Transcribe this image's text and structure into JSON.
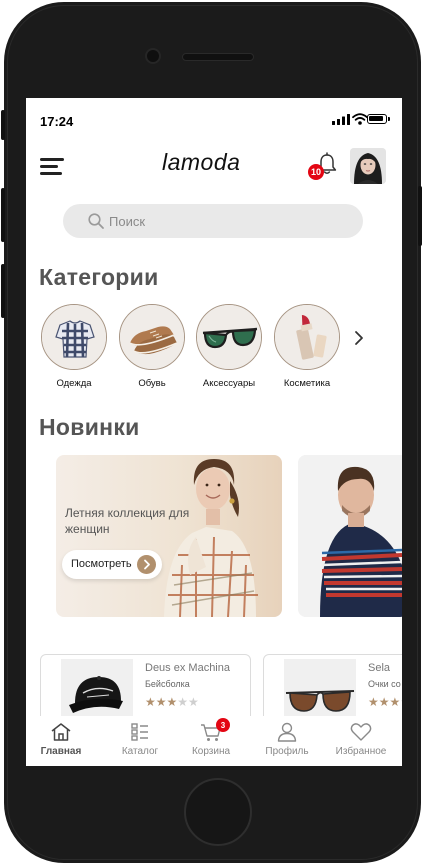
{
  "status_bar": {
    "time": "17:24"
  },
  "header": {
    "logo": "lamoda",
    "notifications_count": "10"
  },
  "search": {
    "placeholder": "Поиск"
  },
  "categories": {
    "title": "Категории",
    "items": [
      {
        "label": "Одежда",
        "icon": "shirt-icon"
      },
      {
        "label": "Обувь",
        "icon": "shoes-icon"
      },
      {
        "label": "Аксессуары",
        "icon": "sunglasses-icon"
      },
      {
        "label": "Косметика",
        "icon": "lipstick-icon"
      }
    ]
  },
  "new_arrivals": {
    "title": "Новинки",
    "banner": {
      "text": "Летняя коллекция для женщин",
      "button_label": "Посмотреть"
    }
  },
  "products": [
    {
      "brand": "Deus ex Machina",
      "type": "Бейсболка",
      "rating": 3,
      "max_rating": 5
    },
    {
      "brand": "Sela",
      "type": "Очки со",
      "rating": 3,
      "max_rating": 5
    }
  ],
  "tabbar": {
    "active": "Главная",
    "cart_count": "3",
    "tabs": [
      {
        "label": "Главная",
        "icon": "home-icon"
      },
      {
        "label": "Каталог",
        "icon": "catalog-icon"
      },
      {
        "label": "Корзина",
        "icon": "cart-icon"
      },
      {
        "label": "Профиль",
        "icon": "profile-icon"
      },
      {
        "label": "Избранное",
        "icon": "heart-icon"
      }
    ]
  },
  "colors": {
    "accent": "#b1906d",
    "badge": "#e30613",
    "search_bg": "#e9e9e9",
    "frame": "#1b1b1b"
  }
}
